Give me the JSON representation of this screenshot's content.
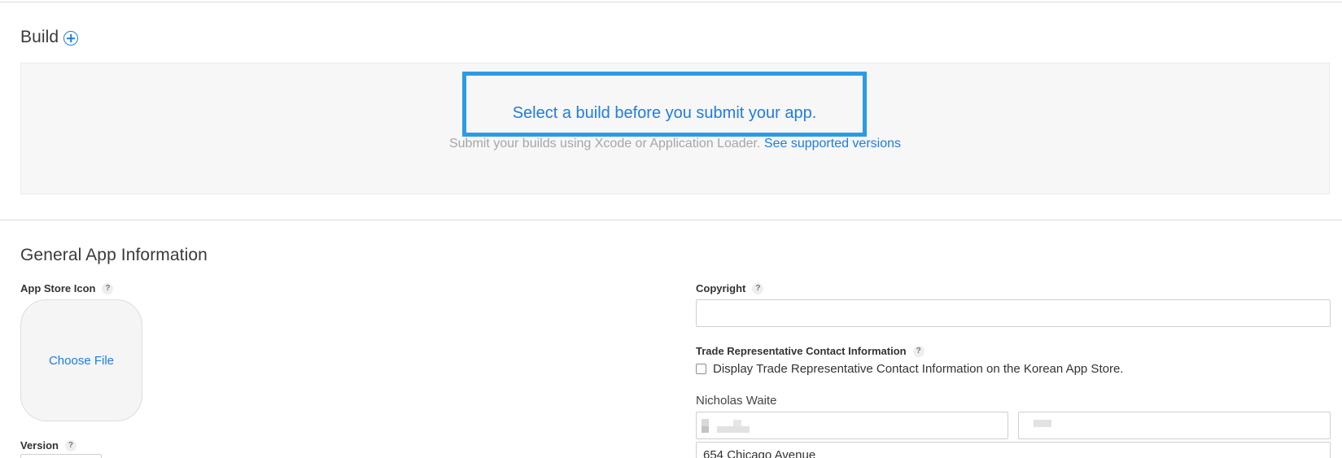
{
  "build": {
    "title": "Build",
    "add_icon": "plus-circle-icon",
    "prompt": "Select a build before you submit your app.",
    "help_text": "Submit your builds using Xcode or Application Loader.",
    "help_link": "See supported versions",
    "highlight_color": "#2c9be6"
  },
  "general": {
    "title": "General App Information",
    "app_store_icon": {
      "label": "App Store Icon",
      "help": "?",
      "choose_label": "Choose File"
    },
    "version": {
      "label": "Version",
      "help": "?"
    },
    "copyright": {
      "label": "Copyright",
      "help": "?",
      "value": ""
    },
    "trade_rep": {
      "label": "Trade Representative Contact Information",
      "help": "?",
      "checkbox_label": "Display Trade Representative Contact Information on the Korean App Store.",
      "checked": false,
      "name": "Nicholas Waite",
      "address_line": "654 Chicago Avenue"
    }
  },
  "colors": {
    "link": "#1d7ce6",
    "muted_text": "#a6a6a6",
    "panel_bg": "#f7f7f7"
  }
}
